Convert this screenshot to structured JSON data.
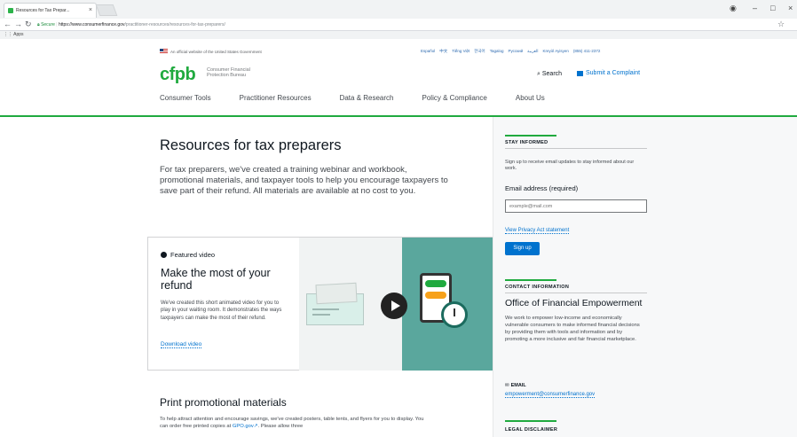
{
  "browser": {
    "tab_title": "Resources for Tax Prepar...",
    "url_secure": "Secure",
    "url_host": "https://www.consumerfinance.gov",
    "url_path": "/practitioner-resources/resources-for-tax-preparers/",
    "bookmarks": "Apps",
    "icons": [
      "back-icon",
      "forward-icon",
      "reload-icon",
      "lock-icon",
      "star-icon",
      "minimize-icon",
      "maximize-icon",
      "close-icon"
    ]
  },
  "gov_banner": "An official website of the United States Government",
  "languages": [
    "Español",
    "中文",
    "Tiếng Việt",
    "한국어",
    "Tagalog",
    "Русский",
    "العربية",
    "Kreyòl Ayisyen",
    "(855) 411-2372"
  ],
  "header": {
    "logo": "cfpb",
    "logo_sub": "Consumer Financial Protection Bureau",
    "search": "Search",
    "complaint": "Submit a Complaint"
  },
  "nav": [
    "Consumer Tools",
    "Practitioner Resources",
    "Data & Research",
    "Policy & Compliance",
    "About Us"
  ],
  "main": {
    "title": "Resources for tax preparers",
    "intro": "For tax preparers, we've created a training webinar and workbook, promotional materials, and taxpayer tools to help you encourage taxpayers to save part of their refund. All materials are available at no cost to you.",
    "featured": {
      "label": "Featured video",
      "title": "Make the most of your refund",
      "desc": "We've created this short animated video for you to play in your waiting room. It demonstrates the ways taxpayers can make the most of their refund.",
      "link": "Download video"
    },
    "print_title": "Print promotional materials",
    "print_desc_1": "To help attract attention and encourage savings, we've created posters, table tents, and flyers for you to display. You can order free printed copies at",
    "print_link": "GPO.gov",
    "print_desc_2": ". Please allow three"
  },
  "sidebar": {
    "stay_head": "STAY INFORMED",
    "signup_text": "Sign up to receive email updates to stay informed about our work.",
    "email_label": "Email address (required)",
    "email_placeholder": "example@mail.com",
    "privacy": "View Privacy Act statement",
    "signup_btn": "Sign up",
    "contact_head": "CONTACT INFORMATION",
    "office": "Office of Financial Empowerment",
    "office_desc": "We work to empower low-income and economically vulnerable consumers to make informed financial decisions by providing them with tools and information and by promoting a more inclusive and fair financial marketplace.",
    "email_head": "EMAIL",
    "email_link": "empowerment@consumerfinance.gov",
    "legal_head": "LEGAL DISCLAIMER"
  },
  "colors": {
    "brand_green": "#20aa3f",
    "link_blue": "#0072ce",
    "teal": "#5aa79d"
  }
}
